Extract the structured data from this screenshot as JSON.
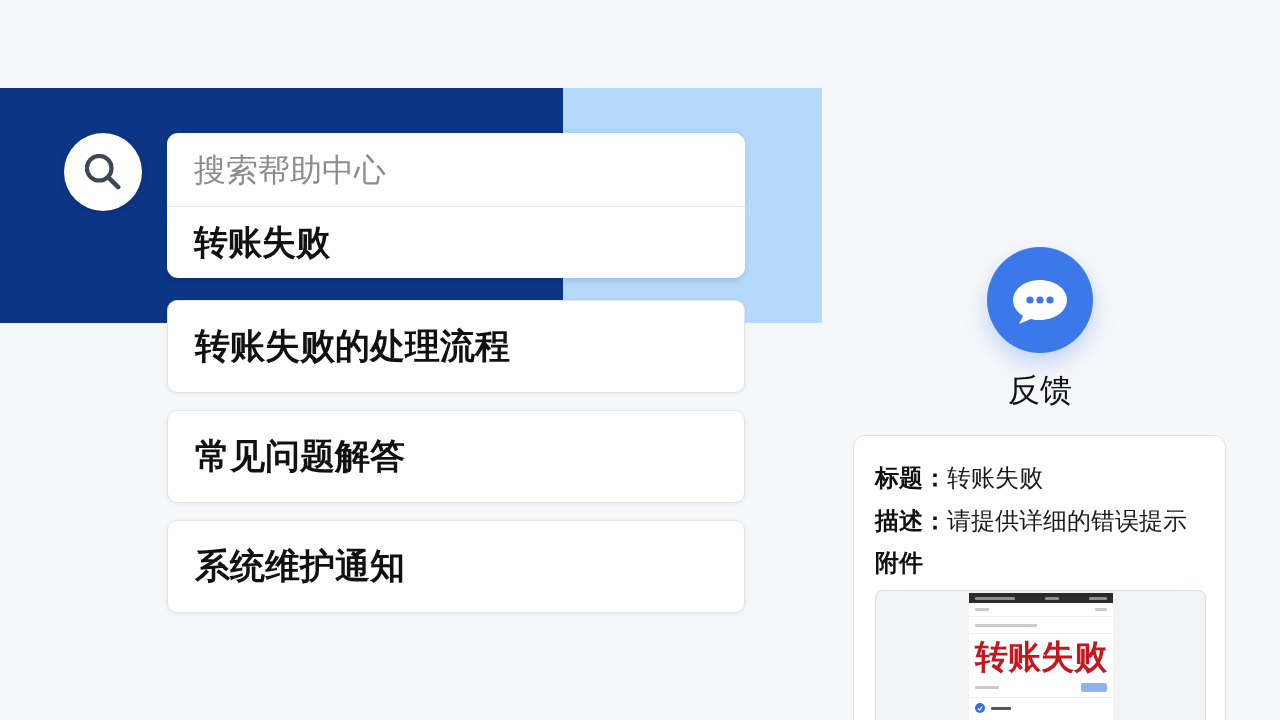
{
  "search": {
    "placeholder": "搜索帮助中心",
    "suggestions": [
      {
        "label": "转账失败"
      }
    ]
  },
  "results": [
    {
      "title": "转账失败的处理流程"
    },
    {
      "title": "常见问题解答"
    },
    {
      "title": "系统维护通知"
    }
  ],
  "feedback": {
    "button_label": "反馈",
    "form": {
      "fields": [
        {
          "label": "标题：",
          "value": "转账失败"
        },
        {
          "label": "描述：",
          "value": "请提供详细的错误提示"
        }
      ],
      "attachment": {
        "label": "附件",
        "screenshot": {
          "heading": "转账失败"
        }
      }
    }
  }
}
